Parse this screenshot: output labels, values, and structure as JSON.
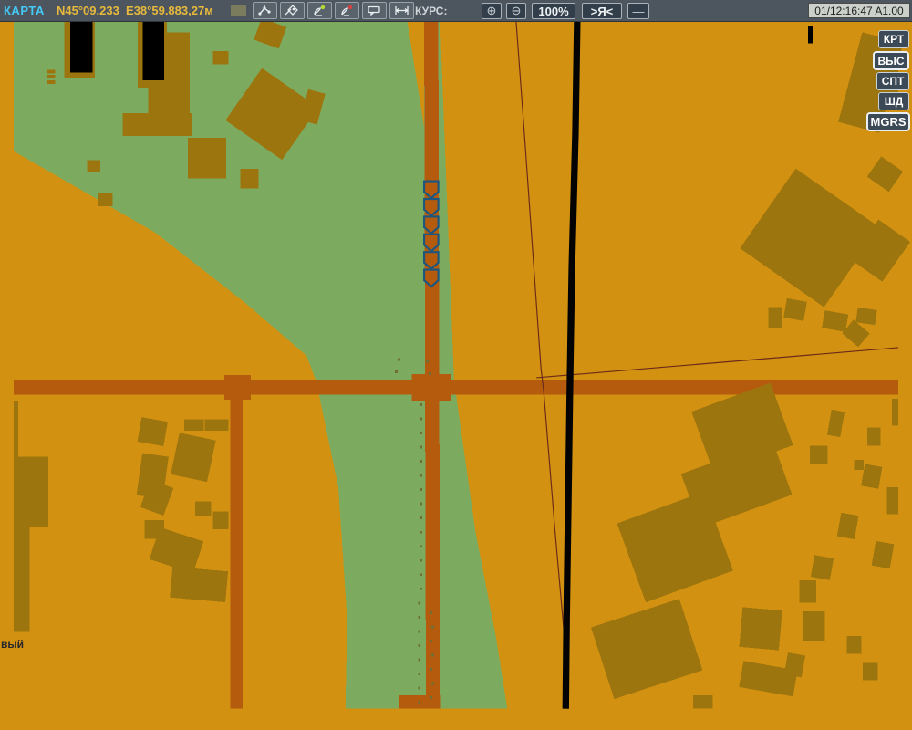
{
  "toolbar": {
    "title": "КАРТА",
    "coordinates": "N45°09.233  E38°59.883,27м",
    "course_label": "КУРС:",
    "zoom_in_label": "⊕",
    "zoom_out_label": "⊖",
    "zoom_level": "100%",
    "center_button_label": ">Я<",
    "dash_button_label": "—",
    "timestamp": "01/12:16:47 A1.00",
    "icons": [
      {
        "name": "route-icon"
      },
      {
        "name": "compass-icon"
      },
      {
        "name": "satellite-dish-green-icon"
      },
      {
        "name": "satellite-dish-red-icon"
      },
      {
        "name": "message-icon"
      },
      {
        "name": "ruler-icon"
      }
    ]
  },
  "side_panel": {
    "buttons": [
      {
        "label": "КРТ"
      },
      {
        "label": "ВЫС"
      },
      {
        "label": "СПТ"
      },
      {
        "label": "ШД"
      },
      {
        "label": "MGRS"
      }
    ]
  },
  "map": {
    "bottom_left_label": "вый",
    "convoy_marker_count": 6,
    "colors": {
      "terrain_orange": "#d29110",
      "vegetation_green": "#7cab60",
      "building_olive": "#9d750e",
      "road_brown": "#b45b0e",
      "railway_black": "#030303",
      "boundary_line": "#6b2a1a",
      "marker_blue": "#1c567f",
      "accent_cyan": "#45c8f5",
      "accent_yellow": "#e7b93c"
    }
  }
}
